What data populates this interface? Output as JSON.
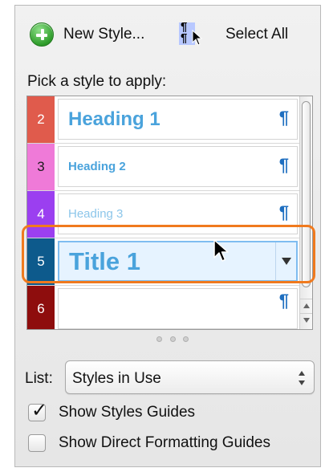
{
  "toolbar": {
    "new_style_label": "New Style...",
    "select_all_label": "Select All"
  },
  "pick_label": "Pick a style to apply:",
  "styles": [
    {
      "number": "2",
      "name": "Heading 1",
      "swatch": "#e05b4c",
      "marker": "¶"
    },
    {
      "number": "3",
      "name": "Heading 2",
      "swatch": "#ef7ad8",
      "marker": "¶"
    },
    {
      "number": "4",
      "name": "Heading 3",
      "swatch": "#9b3ff0",
      "marker": "¶"
    },
    {
      "number": "5",
      "name": "Title 1",
      "swatch": "#0d5a8c",
      "marker": ""
    },
    {
      "number": "6",
      "name": "",
      "swatch": "#8e0d0d",
      "marker": "¶"
    }
  ],
  "selected_style": "Title 1",
  "list": {
    "label": "List:",
    "value": "Styles in Use"
  },
  "options": {
    "show_styles_guides": {
      "label": "Show Styles Guides",
      "checked": true,
      "checkmark": "✓"
    },
    "show_direct_formatting_guides": {
      "label": "Show Direct Formatting Guides",
      "checked": false
    }
  },
  "colors": {
    "accent_highlight": "#f07a1e",
    "style_text": "#4aa3dc",
    "pilcrow": "#1f6fc0"
  }
}
